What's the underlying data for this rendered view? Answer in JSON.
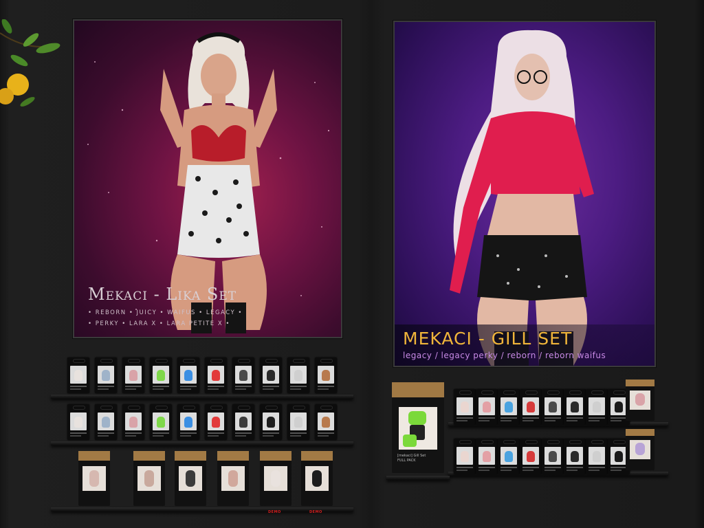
{
  "posters": {
    "lika": {
      "title": "Mekaci - Lika Set",
      "bodies_line1": "• REBORN • JUICY • WAIFUS • LEGACY •",
      "bodies_line2": "• PERKY • LARA X • LARA PETITE X •"
    },
    "gill": {
      "title": "MEKACI - GILL SET",
      "bodies": "legacy / legacy perky / reborn / reborn waifus"
    }
  },
  "lika_display": {
    "row1_colors": [
      "#e8e2de",
      "#9fb3c9",
      "#d9a3a8",
      "#7fd84a",
      "#3b8fe3",
      "#e23a3a",
      "#4a4a4a",
      "#2b2b2b",
      "#cfcfcf",
      "#b87a4d"
    ],
    "row2_colors": [
      "#e8e2de",
      "#9fb3c9",
      "#d9a3a8",
      "#7fd84a",
      "#3b8fe3",
      "#e23a3a",
      "#3a3a3a",
      "#1e1e1e",
      "#cfcfcf",
      "#b87a4d"
    ],
    "row3_colors": [
      "#d6b8b0",
      "#c9a99d",
      "#3b3b3b",
      "#d1a89c",
      "#e9e2de",
      "#1c1c1c"
    ],
    "demo_label": "DEMO"
  },
  "gill_display": {
    "row1_colors": [
      "#ead6d0",
      "#e3a0a5",
      "#4aa3e0",
      "#d63b3b",
      "#4a4a4a",
      "#2a2a2a",
      "#cfcfcf",
      "#1a1a1a"
    ],
    "row2_colors": [
      "#ead6d0",
      "#e3a0a5",
      "#4aa3e0",
      "#d63b3b",
      "#4a4a4a",
      "#2a2a2a",
      "#cfcfcf",
      "#1a1a1a"
    ],
    "fatpack_top_color": "#d9a3a8",
    "fatpack_bottom_color": "#b8a3d6",
    "fullpack_label": "[mekaci] Gill Set",
    "fullpack_sub": "FULL PACK"
  }
}
